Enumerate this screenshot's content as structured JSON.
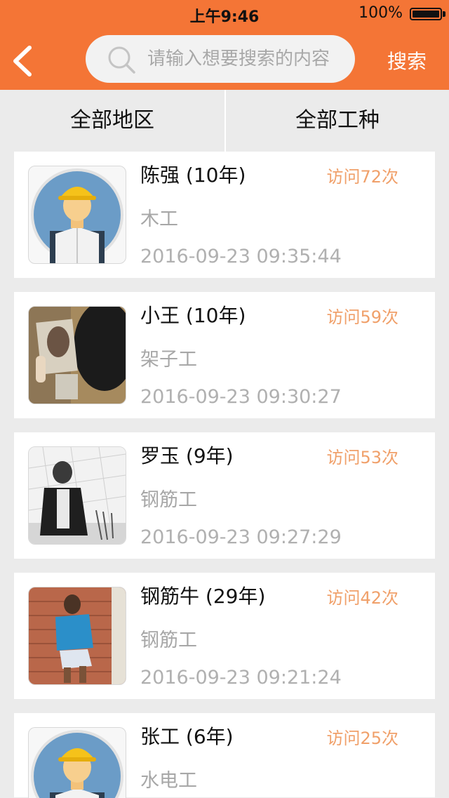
{
  "status_bar": {
    "time": "上午9:46",
    "battery": "100%"
  },
  "header": {
    "search_placeholder": "请输入想要搜索的内容",
    "search_button": "搜索",
    "back_icon": "chevron-left-icon",
    "search_icon": "magnifier-icon"
  },
  "filters": {
    "region": "全部地区",
    "trade": "全部工种"
  },
  "workers": [
    {
      "name": "陈强 (10年)",
      "visits": "访问72次",
      "job": "木工",
      "date": "2016-09-23 09:35:44",
      "avatar": "worker-cartoon-avatar"
    },
    {
      "name": "小王 (10年)",
      "visits": "访问59次",
      "job": "架子工",
      "date": "2016-09-23 09:30:27",
      "avatar": "photo-avatar"
    },
    {
      "name": "罗玉 (9年)",
      "visits": "访问53次",
      "job": "钢筋工",
      "date": "2016-09-23 09:27:29",
      "avatar": "photo-avatar"
    },
    {
      "name": "钢筋牛 (29年)",
      "visits": "访问42次",
      "job": "钢筋工",
      "date": "2016-09-23 09:21:24",
      "avatar": "photo-avatar"
    },
    {
      "name": "张工 (6年)",
      "visits": "访问25次",
      "job": "水电工",
      "date": "",
      "avatar": "worker-cartoon-avatar"
    }
  ],
  "colors": {
    "brand": "#f47536",
    "visits": "#f0a06a",
    "muted": "#a7a7a7",
    "background": "#ebebeb"
  }
}
